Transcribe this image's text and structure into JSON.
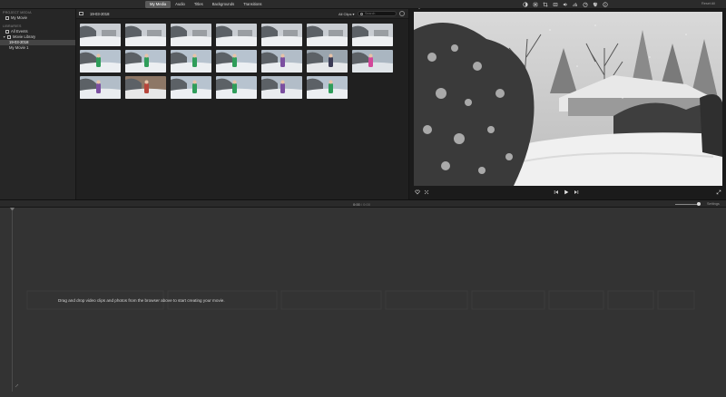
{
  "toolbar": {
    "tabs": [
      "My Media",
      "Audio",
      "Titles",
      "Backgrounds",
      "Transitions"
    ],
    "active_tab": "My Media",
    "reset_all_label": "Reset All",
    "viewer_tools": [
      "color-balance-icon",
      "color-correction-icon",
      "crop-icon",
      "stabilization-icon",
      "volume-icon",
      "noise-reduction-icon",
      "speed-icon",
      "filter-icon",
      "info-icon"
    ]
  },
  "sidebar": {
    "project_media_heading": "PROJECT MEDIA",
    "project_item": "My Movie",
    "libraries_heading": "LIBRARIES",
    "all_events": "All Events",
    "library_name": "Movie Library",
    "event_date": "19-03-2018",
    "movie_item": "My Movie 1"
  },
  "browser": {
    "event_title": "19-03-2018",
    "filter_label": "All Clips ▾",
    "search_placeholder": "Search",
    "thumbnails": [
      [
        "snow-yard",
        "snow-yard",
        "snow-yard",
        "snow-yard",
        "snow-yard",
        "snow-yard",
        "snow-yard"
      ],
      [
        "child-green",
        "child-green",
        "child-green",
        "child-green",
        "child-purple",
        "child-two",
        "child-closeup"
      ],
      [
        "child-purple",
        "child-red",
        "child-green",
        "child-green",
        "child-purple",
        "child-green"
      ]
    ]
  },
  "viewer": {
    "controls": [
      "heart-icon",
      "fullscreen-fit-icon",
      "skip-back-icon",
      "play-icon",
      "skip-forward-icon",
      "expand-icon"
    ]
  },
  "timeline": {
    "timecode_current": "0:00",
    "timecode_separator": " / ",
    "timecode_total": "0:00",
    "settings_label": "Settings",
    "drop_hint": "Drag and drop video clips and photos from the browser above to start creating your movie."
  },
  "colors": {
    "accent": "#5a5a5a",
    "background": "#1f1f1f",
    "timeline_bg": "#333333"
  }
}
